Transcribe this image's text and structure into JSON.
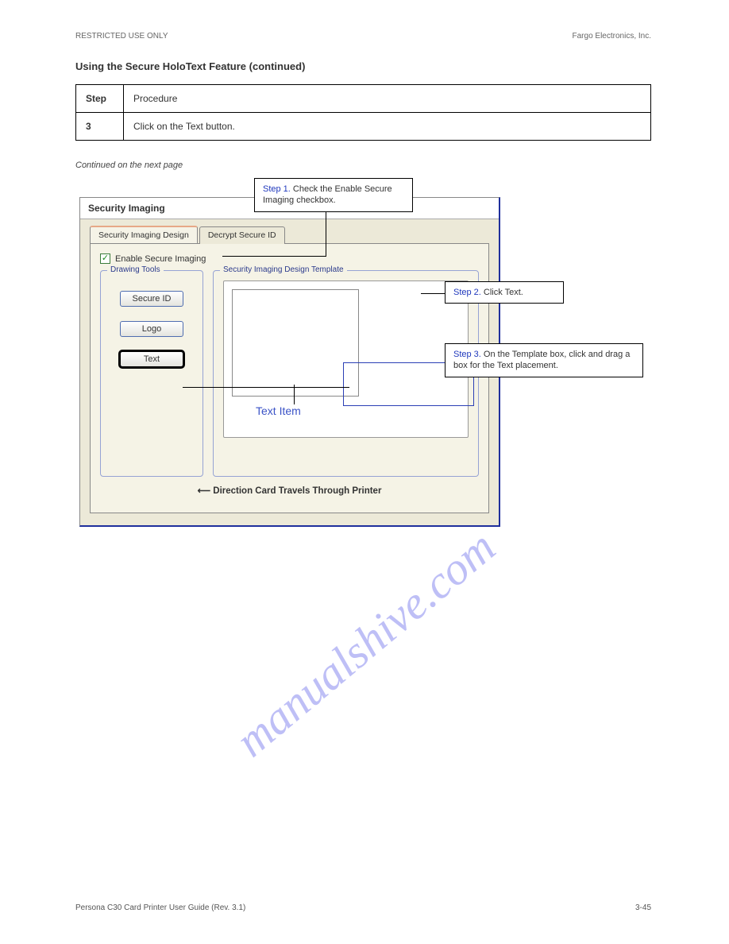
{
  "header": {
    "left": "RESTRICTED USE ONLY",
    "right": "Fargo Electronics, Inc."
  },
  "title": "Using the Secure HoloText Feature (continued)",
  "steps": [
    {
      "n": "Step",
      "label": "Procedure"
    },
    {
      "n": "3",
      "label": "Click on the Text button."
    }
  ],
  "continued": "Continued on the next page",
  "callouts": {
    "c1_step": "Step 1.",
    "c1_text": "Check the Enable Secure Imaging checkbox.",
    "c2_step": "Step 2.",
    "c2_text": "Click Text.",
    "c3_step": "Step 3.",
    "c3_text": "On the Template box, click and drag a box for the Text placement."
  },
  "win": {
    "title": "Security Imaging",
    "tab1": "Security Imaging Design",
    "tab2": "Decrypt Secure ID",
    "check_label": "Enable Secure Imaging",
    "group_tools": "Drawing Tools",
    "group_template": "Security Imaging Design Template",
    "btn_secureid": "Secure ID",
    "btn_logo": "Logo",
    "btn_text": "Text",
    "text_item": "Text Item",
    "direction": "Direction Card Travels Through Printer"
  },
  "watermark": "manualshive.com",
  "footer": {
    "left": "Persona C30 Card Printer User Guide (Rev. 3.1)",
    "right": "3-45"
  }
}
